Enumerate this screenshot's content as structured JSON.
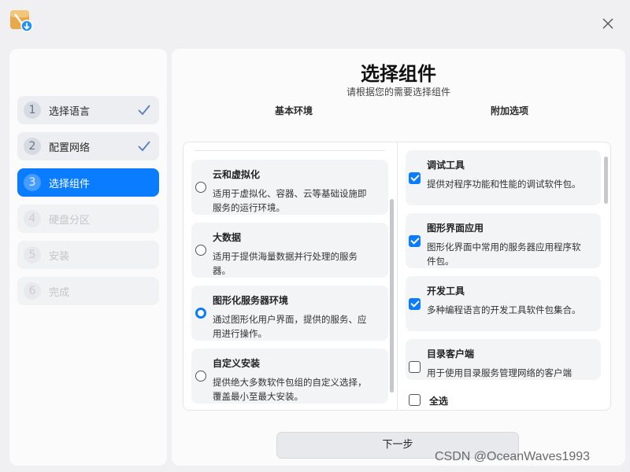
{
  "colors": {
    "accent": "#0a7cff",
    "background": "#f0f0f2",
    "panel": "#fbfbfc"
  },
  "sidebar": {
    "steps": [
      {
        "number": "1",
        "label": "选择语言",
        "state": "done"
      },
      {
        "number": "2",
        "label": "配置网络",
        "state": "done"
      },
      {
        "number": "3",
        "label": "选择组件",
        "state": "active"
      },
      {
        "number": "4",
        "label": "硬盘分区",
        "state": "disabled"
      },
      {
        "number": "5",
        "label": "安装",
        "state": "disabled"
      },
      {
        "number": "6",
        "label": "完成",
        "state": "disabled"
      }
    ]
  },
  "main": {
    "title": "选择组件",
    "subtitle": "请根据您的需要选择组件",
    "base_env_header": "基本环境",
    "addons_header": "附加选项",
    "environments": [
      {
        "title": "云和虚拟化",
        "desc": "适用于虚拟化、容器、云等基础设施即服务的运行环境。",
        "selected": false
      },
      {
        "title": "大数据",
        "desc": "适用于提供海量数据并行处理的服务器。",
        "selected": false
      },
      {
        "title": "图形化服务器环境",
        "desc": "通过图形化用户界面，提供的服务、应用进行操作。",
        "selected": true
      },
      {
        "title": "自定义安装",
        "desc": "提供绝大多数软件包组的自定义选择，覆盖最小至最大安装。",
        "selected": false
      }
    ],
    "addons": [
      {
        "title": "调试工具",
        "desc": "提供对程序功能和性能的调试软件包。",
        "checked": true
      },
      {
        "title": "图形界面应用",
        "desc": "图形化界面中常用的服务器应用程序软件包。",
        "checked": true
      },
      {
        "title": "开发工具",
        "desc": "多种编程语言的开发工具软件包集合。",
        "checked": true
      },
      {
        "title": "目录客户端",
        "desc": "用于使用目录服务管理网络的客户端",
        "checked": false
      }
    ],
    "select_all_label": "全选",
    "next_button": "下一步"
  },
  "watermark": "CSDN @OceanWaves1993",
  "icons": [
    "app-installer-icon",
    "close-icon",
    "check-icon"
  ]
}
